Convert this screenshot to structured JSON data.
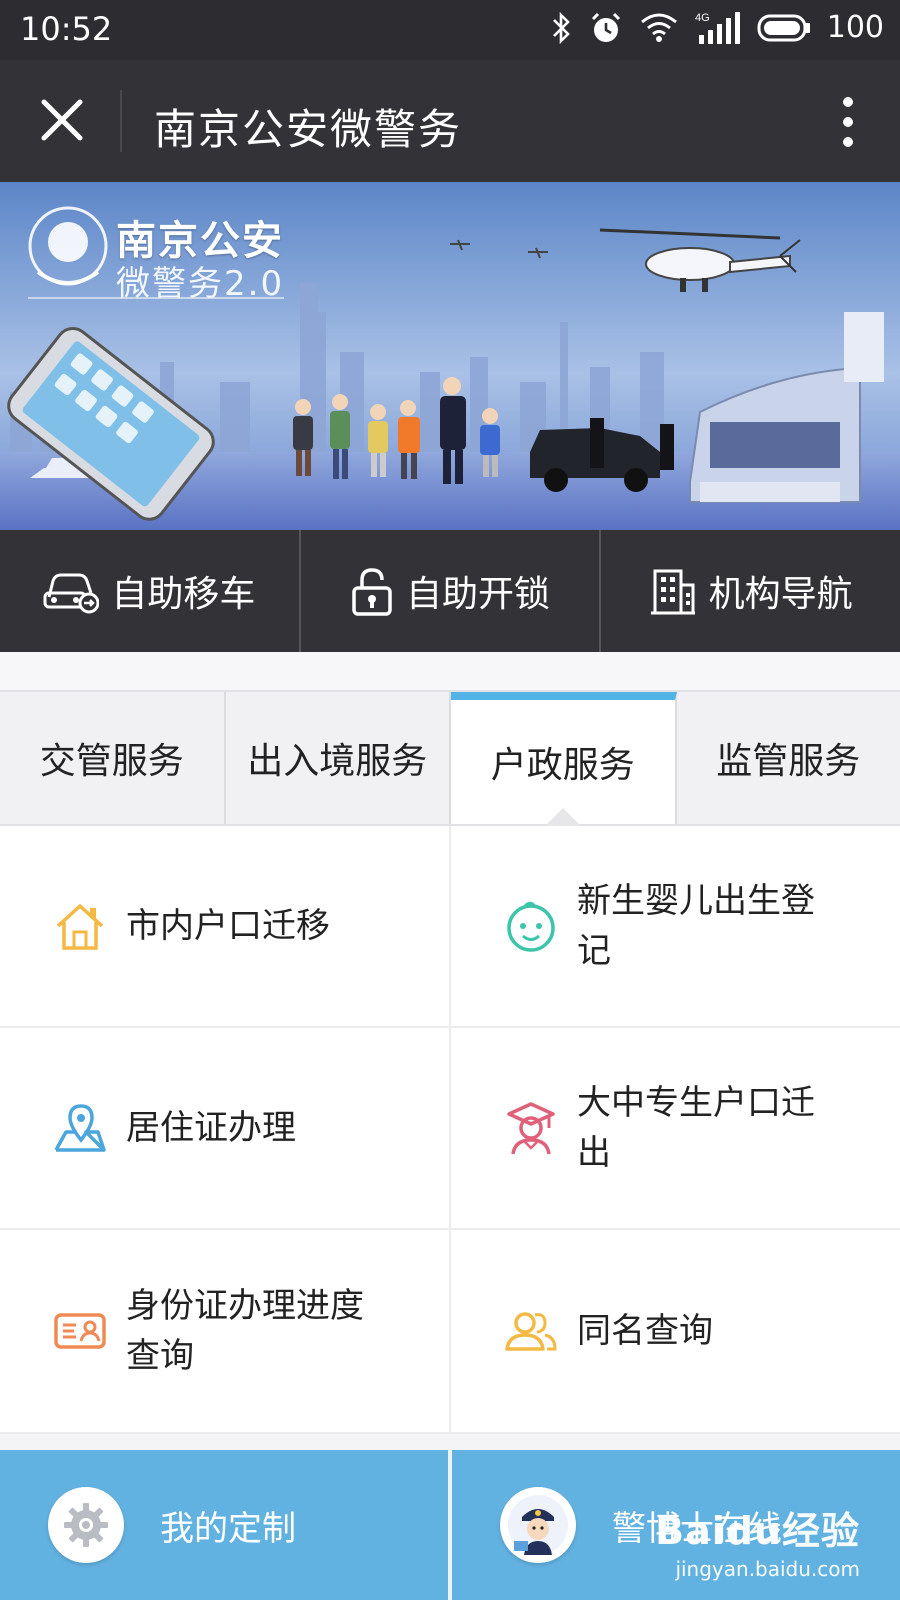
{
  "status_bar": {
    "time": "10:52",
    "signal": "4G",
    "battery": "100"
  },
  "navbar": {
    "title": "南京公安微警务"
  },
  "banner": {
    "logo_line1": "南京公安",
    "logo_line2": "微警务2.0"
  },
  "quick_actions": [
    {
      "label": "自助移车",
      "icon": "car-icon"
    },
    {
      "label": "自助开锁",
      "icon": "lock-icon"
    },
    {
      "label": "机构导航",
      "icon": "building-icon"
    }
  ],
  "tabs": [
    {
      "label": "交管服务",
      "active": false
    },
    {
      "label": "出入境服务",
      "active": false
    },
    {
      "label": "户政服务",
      "active": true
    },
    {
      "label": "监管服务",
      "active": false
    }
  ],
  "services": [
    {
      "label": "市内户口迁移",
      "icon": "house-icon",
      "color": "#f4b942"
    },
    {
      "label": "新生婴儿出生登记",
      "icon": "baby-face-icon",
      "color": "#3cc5a8"
    },
    {
      "label": "居住证办理",
      "icon": "map-pin-icon",
      "color": "#4aa6dc"
    },
    {
      "label": "大中专生户口迁出",
      "icon": "graduate-icon",
      "color": "#e0607a"
    },
    {
      "label": "身份证办理进度查询",
      "icon": "id-card-icon",
      "color": "#ef8a55"
    },
    {
      "label": "同名查询",
      "icon": "people-icon",
      "color": "#f4b942"
    }
  ],
  "bottom_bar": [
    {
      "label": "我的定制",
      "icon": "gear-icon"
    },
    {
      "label": "警博士在线",
      "icon": "police-avatar-icon"
    }
  ],
  "watermark": {
    "line1": "Baidu经验",
    "line2": "jingyan.baidu.com"
  },
  "colors": {
    "accent": "#52b3e6",
    "bottom_bar": "#62b2e1",
    "dark_bar": "#333337"
  }
}
